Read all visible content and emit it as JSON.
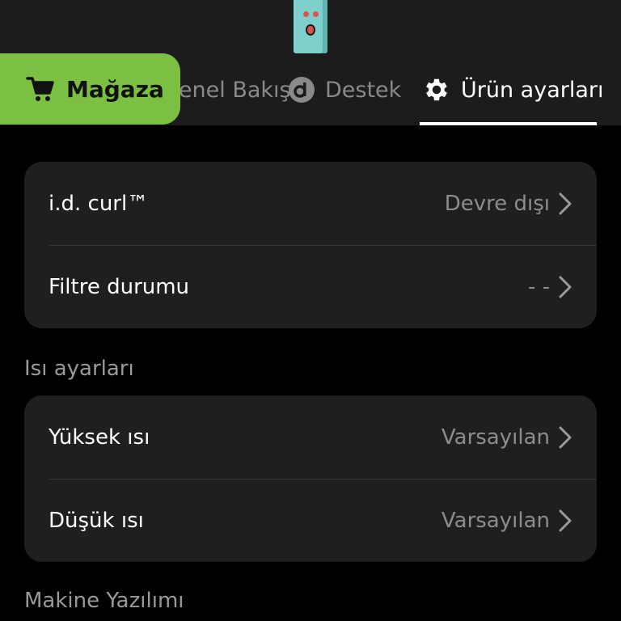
{
  "header": {
    "store_button": "Mağaza",
    "tabs": [
      {
        "label": "Genel Bakış"
      },
      {
        "label": "Destek"
      },
      {
        "label": "Ürün ayarları"
      }
    ]
  },
  "card1": {
    "rows": [
      {
        "label": "i.d. curl™",
        "value": "Devre dışı"
      },
      {
        "label": "Filtre durumu",
        "value": "- -"
      }
    ]
  },
  "section_heat": {
    "title": "Isı ayarları"
  },
  "card2": {
    "rows": [
      {
        "label": "Yüksek ısı",
        "value": "Varsayılan"
      },
      {
        "label": "Düşük ısı",
        "value": "Varsayılan"
      }
    ]
  },
  "section_firmware": {
    "title": "Makine Yazılımı"
  },
  "colors": {
    "accent": "#7bc043",
    "background": "#000000",
    "card": "#1f1f1f"
  },
  "icons": {
    "store": "cart-icon",
    "support": "support-d-icon",
    "settings": "gear-icon",
    "row": "chevron-right-icon"
  }
}
